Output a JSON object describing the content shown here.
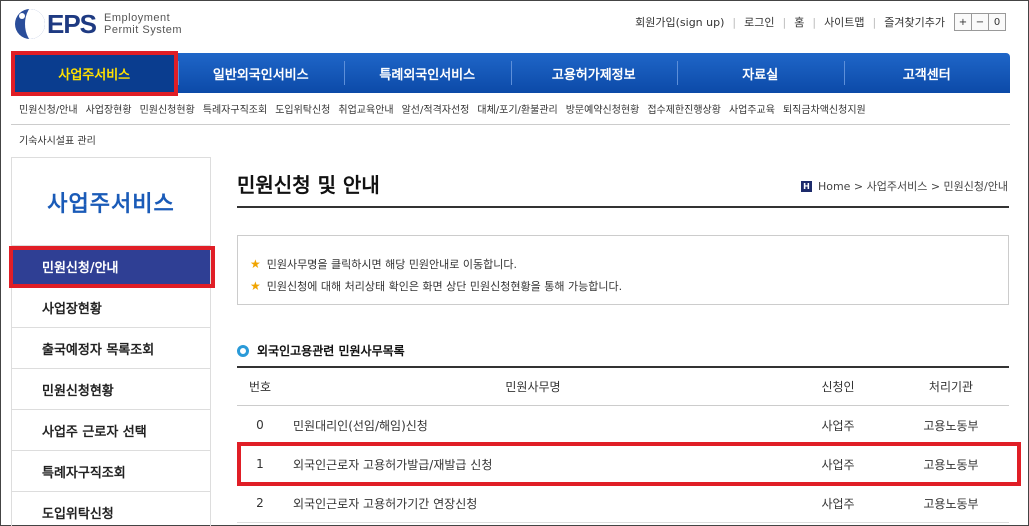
{
  "header": {
    "logo_text": "EPS",
    "logo_sub_line1": "Employment",
    "logo_sub_line2": "Permit System",
    "util_links": [
      "회원가입(sign up)",
      "로그인",
      "홈",
      "사이트맵",
      "즐겨찾기추가"
    ],
    "font_controls": [
      "+",
      "−",
      "0"
    ]
  },
  "gnb": {
    "items": [
      "사업주서비스",
      "일반외국인서비스",
      "특례외국인서비스",
      "고용허가제정보",
      "자료실",
      "고객센터"
    ],
    "active_color": "#ffe000"
  },
  "subnav": {
    "items": [
      "민원신청/안내",
      "사업장현황",
      "민원신청현황",
      "특례자구직조회",
      "도입위탁신청",
      "취업교육안내",
      "알선/적격자선정",
      "대체/포기/환불관리",
      "방문예약신청현황",
      "접수제한진행상황",
      "사업주교육",
      "퇴직금차액신청지원"
    ],
    "second_line": "기숙사시설표 관리"
  },
  "lnb": {
    "title": "사업주서비스",
    "items": [
      "민원신청/안내",
      "사업장현황",
      "출국예정자 목록조회",
      "민원신청현황",
      "사업주 근로자 선택",
      "특례자구직조회",
      "도입위탁신청"
    ]
  },
  "content": {
    "page_title": "민원신청 및 안내",
    "breadcrumb_icon": "H",
    "breadcrumb": "Home > 사업주서비스 > 민원신청/안내",
    "notices": [
      "민원사무명을 클릭하시면 해당 민원안내로 이동합니다.",
      "민원신청에 대해 처리상태 확인은 화면 상단 민원신청현황을 통해 가능합니다."
    ],
    "section_title": "외국인고용관련 민원사무목록",
    "table": {
      "headers": [
        "번호",
        "민원사무명",
        "신청인",
        "처리기관"
      ],
      "rows": [
        {
          "no": "0",
          "name": "민원대리인(선임/해임)신청",
          "by": "사업주",
          "agency": "고용노동부"
        },
        {
          "no": "1",
          "name": "외국인근로자 고용허가발급/재발급 신청",
          "by": "사업주",
          "agency": "고용노동부"
        },
        {
          "no": "2",
          "name": "외국인근로자 고용허가기간 연장신청",
          "by": "사업주",
          "agency": "고용노동부"
        }
      ]
    }
  },
  "colors": {
    "brand_blue": "#1f66c8",
    "highlight_red": "#e01e26",
    "lnb_active": "#2f3f94"
  }
}
